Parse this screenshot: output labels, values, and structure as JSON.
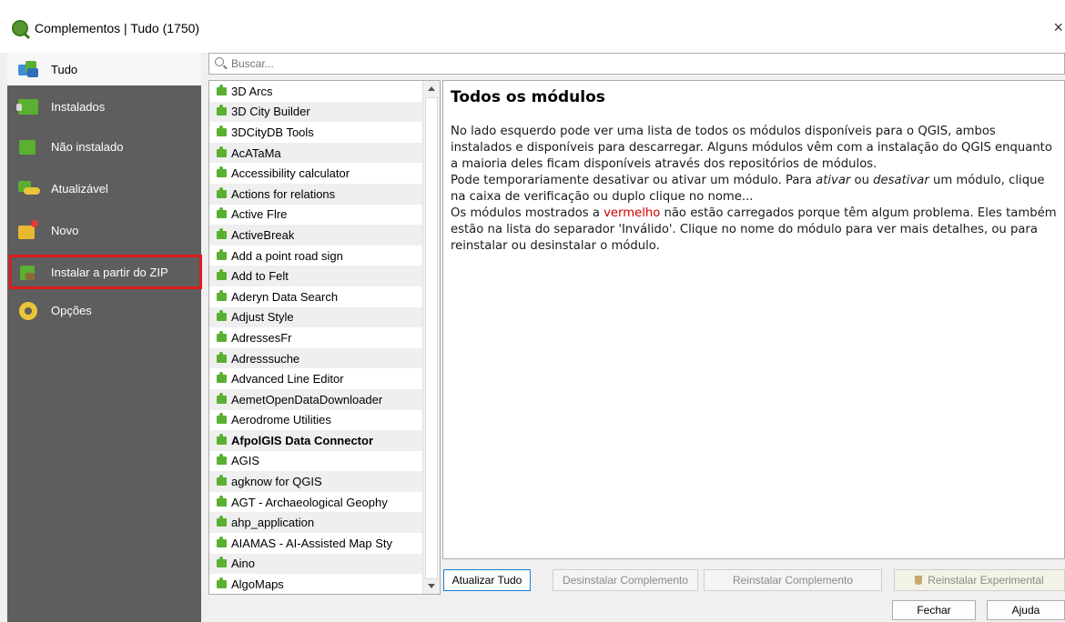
{
  "window": {
    "title": "Complementos | Tudo (1750)",
    "close_glyph": "×"
  },
  "sidebar": {
    "items": [
      {
        "label": "Tudo",
        "icon": "all-plugins-icon"
      },
      {
        "label": "Instalados",
        "icon": "installed-plugins-icon"
      },
      {
        "label": "Não instalado",
        "icon": "not-installed-icon"
      },
      {
        "label": "Atualizável",
        "icon": "upgradeable-icon"
      },
      {
        "label": "Novo",
        "icon": "new-plugins-icon"
      },
      {
        "label": "Instalar a partir do ZIP",
        "icon": "install-zip-icon"
      },
      {
        "label": "Opções",
        "icon": "settings-gear-icon"
      }
    ],
    "highlight_color": "#e01b1b"
  },
  "search": {
    "placeholder": "Buscar..."
  },
  "plugins": [
    "3D Arcs",
    "3D City Builder",
    "3DCityDB Tools",
    "AcATaMa",
    "Accessibility calculator",
    "Actions for relations",
    "Active Flre",
    "ActiveBreak",
    "Add a point road sign",
    "Add to Felt",
    "Aderyn Data Search",
    "Adjust Style",
    "AdressesFr",
    "Adresssuche",
    "Advanced Line Editor",
    "AemetOpenDataDownloader",
    "Aerodrome Utilities",
    "AfpolGIS Data Connector",
    "AGIS",
    "agknow for QGIS",
    "AGT - Archaeological Geophy",
    "ahp_application",
    "AIAMAS - AI-Assisted Map Sty",
    "Aino",
    "AlgoMaps"
  ],
  "plugins_bold_index": 17,
  "details": {
    "heading": "Todos os módulos",
    "p1": "No lado esquerdo pode ver uma lista de todos os módulos disponíveis para o QGIS, ambos instalados e disponíveis para descarregar. Alguns módulos vêm com a instalação do QGIS enquanto a maioria deles ficam disponíveis através dos repositórios de módulos.",
    "p2_before": "Pode temporariamente desativar ou ativar um módulo. Para ",
    "p2_em1": "ativar",
    "p2_mid": " ou ",
    "p2_em2": "desativar",
    "p2_after": " um módulo, clique na caixa de verificação ou duplo clique no nome...",
    "p3_before": "Os módulos mostrados a ",
    "p3_red": "vermelho",
    "p3_after": " não estão carregados porque têm algum problema. Eles também estão na lista do separador 'Inválido'. Clique no nome do módulo para ver mais detalhes, ou para reinstalar ou desinstalar o módulo."
  },
  "buttons": {
    "update_all": "Atualizar Tudo",
    "uninstall": "Desinstalar Complemento",
    "reinstall": "Reinstalar Complemento",
    "reinstall_experimental": "Reinstalar Experimental",
    "close": "Fechar",
    "help": "Ajuda"
  },
  "colors": {
    "sidebar_bg": "#5e5e5e",
    "plugin_green": "#5ab030",
    "warning_red": "#d40000"
  }
}
